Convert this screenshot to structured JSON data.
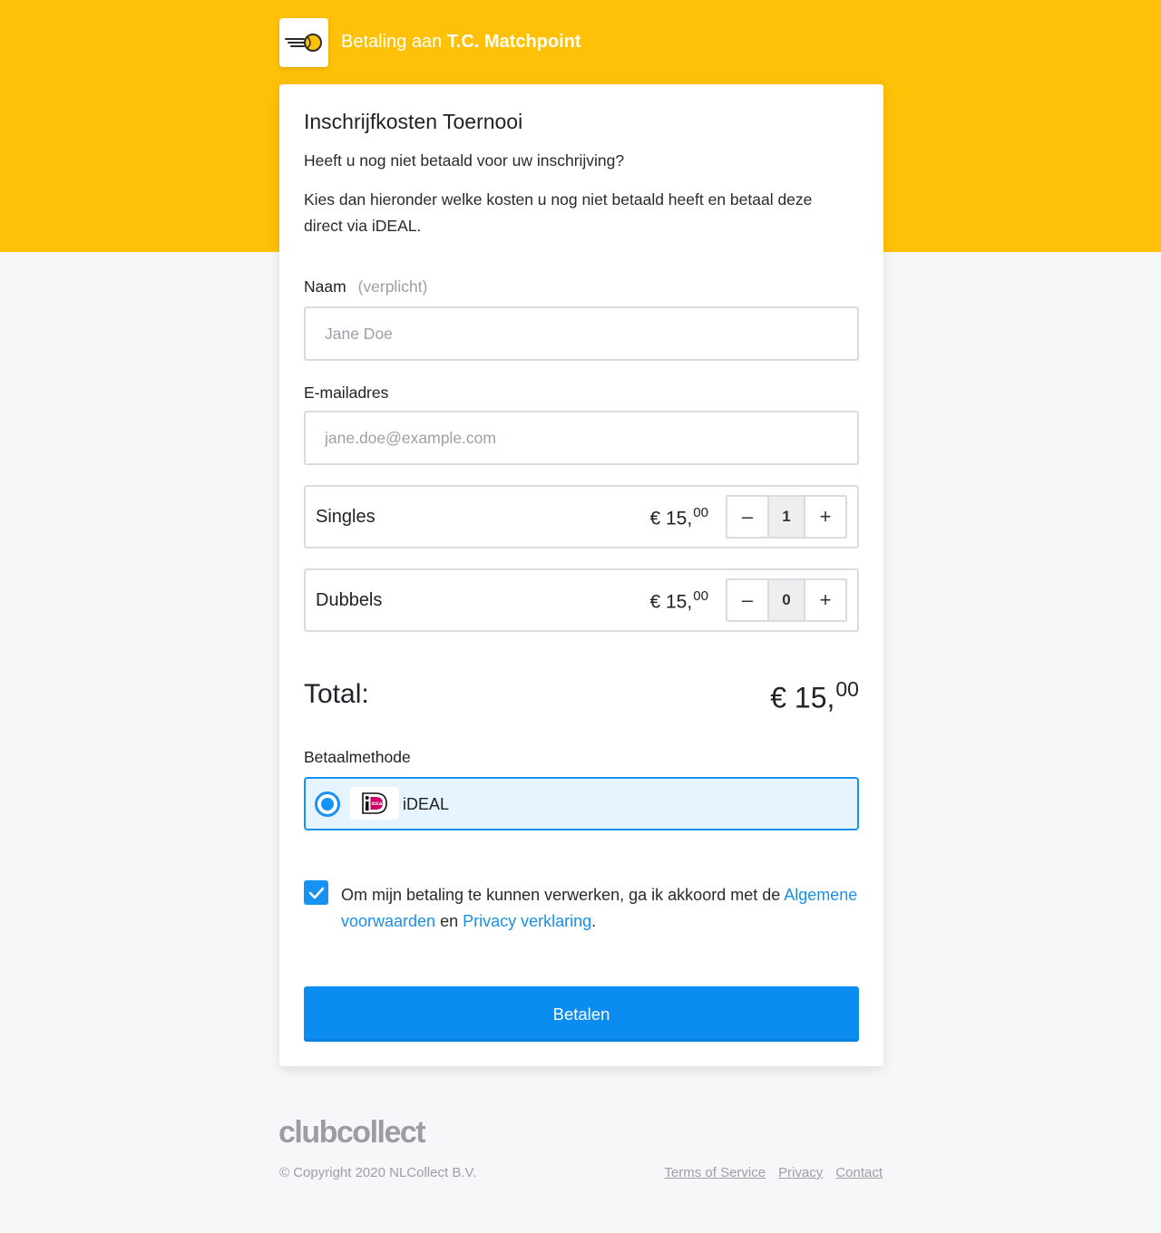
{
  "header": {
    "prefix": "Betaling aan",
    "club_name": "T.C. Matchpoint",
    "logo_icon": "tennis-ball-icon"
  },
  "form": {
    "title": "Inschrijfkosten Toernooi",
    "intro_line1": "Heeft u nog niet betaald voor uw inschrijving?",
    "intro_line2": "Kies dan hieronder welke kosten u nog niet betaald heeft en betaal deze direct via iDEAL.",
    "name_label": "Naam",
    "name_required": "(verplicht)",
    "name_placeholder": "Jane Doe",
    "email_label": "E-mailadres",
    "email_placeholder": "jane.doe@example.com"
  },
  "items": [
    {
      "name": "Singles",
      "currency": "€",
      "price_whole": "15,",
      "price_cents": "00",
      "quantity": "1",
      "minus": "–",
      "plus": "+"
    },
    {
      "name": "Dubbels",
      "currency": "€",
      "price_whole": "15,",
      "price_cents": "00",
      "quantity": "0",
      "minus": "–",
      "plus": "+"
    }
  ],
  "total": {
    "label": "Total:",
    "currency": "€",
    "whole": "15,",
    "cents": "00"
  },
  "payment": {
    "label": "Betaalmethode",
    "method": "iDEAL",
    "selected": true
  },
  "consent": {
    "checked": true,
    "text_before": "Om mijn betaling te kunnen verwerken, ga ik akkoord met de",
    "terms_link": "Algemene voorwaarden",
    "conjunction": "en",
    "privacy_link": "Privacy verklaring",
    "end": "."
  },
  "pay_button": "Betalen",
  "footer": {
    "brand": "clubcollect",
    "copyright": "© Copyright 2020 NLCollect B.V.",
    "links": [
      "Terms of Service",
      "Privacy",
      "Contact"
    ]
  },
  "colors": {
    "banner": "#ffc107",
    "accent": "#1693f2",
    "button": "#0a8cf0"
  }
}
